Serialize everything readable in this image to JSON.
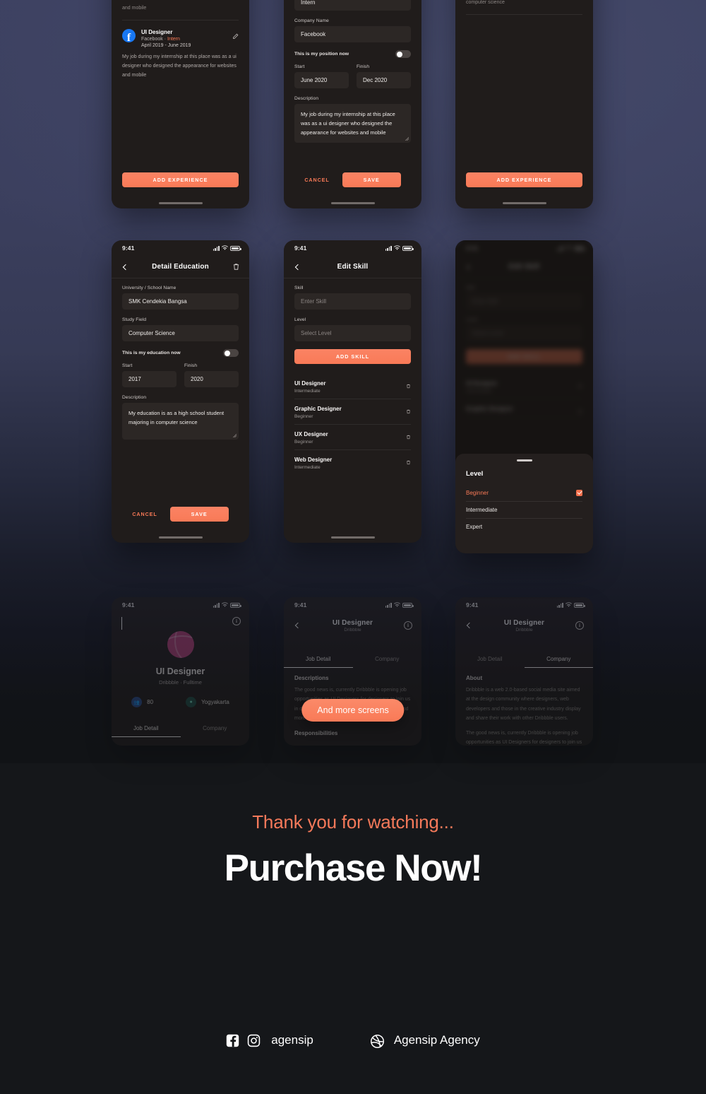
{
  "theme": {
    "accent": "#f97a57",
    "accent_light": "#fa8364",
    "bg_top": "#3c4060",
    "bg_bottom": "#15171a",
    "card": "#201c1b",
    "field": "#2c2725"
  },
  "screens": {
    "experience_list": {
      "truncated_top_text": "and mobile",
      "entry": {
        "role": "UI Designer",
        "company": "Facebook",
        "separator": "·",
        "position": "Intern",
        "dates": "April 2019 - June 2019",
        "description": "My job during my internship at this place was as a ui designer who designed the appearance for websites and mobile",
        "edit_icon": "pencil-icon",
        "logo": "facebook-icon"
      },
      "add_button": "ADD EXPERIENCE"
    },
    "edit_experience": {
      "position_value": "Intern",
      "company_label": "Company Name",
      "company_value": "Facebook",
      "toggle_label": "This is my position now",
      "toggle_on": false,
      "start_label": "Start",
      "start_value": "June 2020",
      "finish_label": "Finish",
      "finish_value": "Dec 2020",
      "description_label": "Description",
      "description_value": "My job during my internship at this place was as a ui designer who designed the appearance for websites and mobile",
      "cancel_label": "CANCEL",
      "save_label": "SAVE"
    },
    "experience_empty": {
      "truncated_top_text": "computer science",
      "add_button": "ADD EXPERIENCE"
    },
    "detail_education": {
      "status_time": "9:41",
      "title": "Detail Education",
      "delete_icon": "trash-icon",
      "back_icon": "chevron-left-icon",
      "school_label": "University / School Name",
      "school_value": "SMK Cendekia Bangsa",
      "study_label": "Study Field",
      "study_value": "Computer Science",
      "toggle_label": "This is my education now",
      "toggle_on": false,
      "start_label": "Start",
      "start_value": "2017",
      "finish_label": "Finish",
      "finish_value": "2020",
      "description_label": "Description",
      "description_value": "My education is as a high school student majoring in computer science",
      "cancel_label": "CANCEL",
      "save_label": "SAVE"
    },
    "edit_skill": {
      "status_time": "9:41",
      "title": "Edit Skill",
      "back_icon": "chevron-left-icon",
      "skill_label": "Skill",
      "skill_placeholder": "Enter Skill",
      "level_label": "Level",
      "level_placeholder": "Select Level",
      "add_button": "ADD SKILL",
      "skills": [
        {
          "name": "UI Designer",
          "level": "Intermediate",
          "delete_icon": "trash-icon"
        },
        {
          "name": "Graphic Designer",
          "level": "Beginner",
          "delete_icon": "trash-icon"
        },
        {
          "name": "UX Designer",
          "level": "Beginner",
          "delete_icon": "trash-icon"
        },
        {
          "name": "Web Designer",
          "level": "Intermediate",
          "delete_icon": "trash-icon"
        }
      ]
    },
    "level_sheet": {
      "status_time": "9:41",
      "title": "Edit Skill",
      "skill_label": "Skill",
      "skill_placeholder": "Enter Skill",
      "level_label": "Level",
      "level_placeholder": "Select Level",
      "add_button": "ADD SKILL",
      "bg_skills": [
        {
          "name": "UI Designer",
          "level": "Intermediate"
        },
        {
          "name": "Graphic Designer",
          "level": ""
        }
      ],
      "sheet_title": "Level",
      "options": [
        {
          "label": "Beginner",
          "selected": true
        },
        {
          "label": "Intermediate",
          "selected": false
        },
        {
          "label": "Expert",
          "selected": false
        }
      ]
    },
    "job_hero": {
      "status_time": "9:41",
      "back_icon": "chevron-left-icon",
      "info_icon": "info-icon",
      "logo": "dribbble-icon",
      "title": "UI Designer",
      "subtitle": "Dribbble  ·  Fulltime",
      "stat_applicants": "80",
      "stat_applicants_icon": "people-icon",
      "stat_location": "Yogyakarta",
      "stat_location_icon": "location-icon",
      "tabs": [
        "Job Detail",
        "Company"
      ],
      "active_tab": "Job Detail"
    },
    "job_detail": {
      "status_time": "9:41",
      "title": "UI Designer",
      "subtitle": "Dribbble",
      "info_icon": "info-icon",
      "tabs": [
        "Job Detail",
        "Company"
      ],
      "active_tab": "Job Detail",
      "section_label": "Descriptions",
      "section_body": "The good news is, currently Dribbble is opening job opportunities as UI Designers for designers to join us in developing and building Dribbble to be bigger and more advanced.",
      "section2_label": "Responsibilities"
    },
    "job_company": {
      "status_time": "9:41",
      "title": "UI Designer",
      "subtitle": "Dribbble",
      "info_icon": "info-icon",
      "tabs": [
        "Job Detail",
        "Company"
      ],
      "active_tab": "Company",
      "section_label": "About",
      "section_body": "Dribbble is a web 2.0-based social media site aimed at the design community where designers, web developers and those in the creative industry display and share their work with other Dribbble users.",
      "section_body2": "The good news is, currently Dribbble is opening job opportunities as UI Designers for designers to join us in developing and building Dribbble to be bigger and more advanced."
    }
  },
  "overlay": {
    "more_screens_label": "And more screens"
  },
  "footer": {
    "thanks": "Thank you for watching...",
    "purchase": "Purchase Now!",
    "socials": [
      {
        "handle": "agensip",
        "icons": [
          "facebook-icon",
          "instagram-icon"
        ]
      },
      {
        "handle": "Agensip Agency",
        "icons": [
          "dribbble-icon"
        ]
      }
    ]
  }
}
